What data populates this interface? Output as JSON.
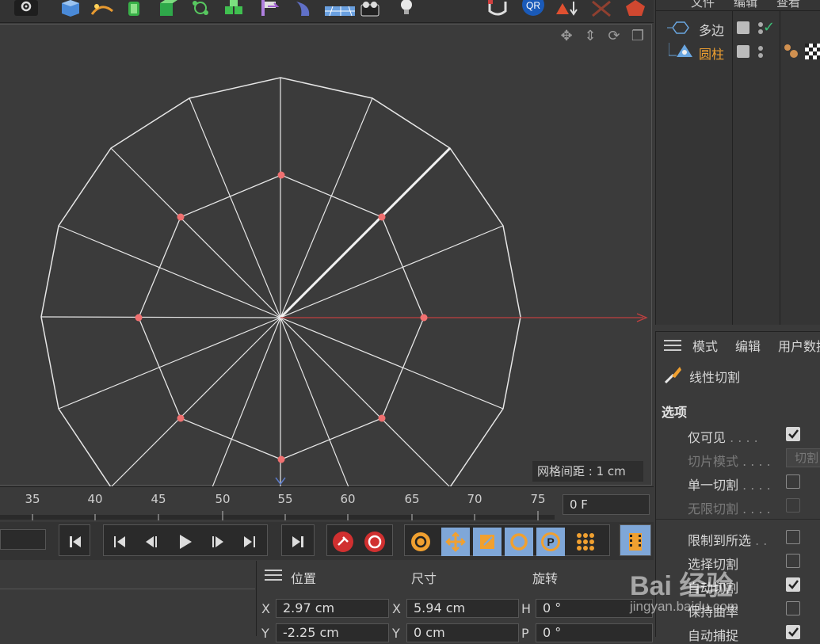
{
  "objects": {
    "menu": [
      "文件",
      "编辑",
      "查看"
    ],
    "items": [
      {
        "name": "多边",
        "selected": false
      },
      {
        "name": "圆柱",
        "selected": true
      }
    ]
  },
  "attributes": {
    "tabs": [
      "模式",
      "编辑",
      "用户数据"
    ],
    "tool_name": "线性切割",
    "section": "选项",
    "options": [
      {
        "label": "仅可见",
        "dots": ". . . .",
        "state": "checked"
      },
      {
        "label": "切片模式",
        "dots": ". . . .",
        "state": "dropdown",
        "value": "切割"
      },
      {
        "label": "单一切割",
        "dots": ". . . .",
        "state": "unchecked"
      },
      {
        "label": "无限切割",
        "dots": ". . . .",
        "state": "disabled"
      },
      {
        "label": "限制到所选",
        "dots": ". .",
        "state": "unchecked"
      },
      {
        "label": "选择切割",
        "dots": "",
        "state": "unchecked"
      },
      {
        "label": "自动切割",
        "dots": "",
        "state": "checked"
      },
      {
        "label": "保持曲率",
        "dots": "",
        "state": "unchecked"
      },
      {
        "label": "自动捕捉",
        "dots": "",
        "state": "checked"
      }
    ]
  },
  "viewport": {
    "grid_spacing": "网格间距 : 1 cm"
  },
  "timeline": {
    "ticks": [
      "35",
      "40",
      "45",
      "50",
      "55",
      "60",
      "65",
      "70",
      "75"
    ],
    "current_frame": "0 F"
  },
  "coordinates": {
    "headers": [
      "位置",
      "尺寸",
      "旋转"
    ],
    "rows": [
      {
        "axis_pos": "X",
        "pos": "2.97 cm",
        "axis_size": "X",
        "size": "5.94 cm",
        "axis_rot": "H",
        "rot": "0 °"
      },
      {
        "axis_pos": "Y",
        "pos": "-2.25 cm",
        "axis_size": "Y",
        "size": "0 cm",
        "axis_rot": "P",
        "rot": "0 °"
      }
    ]
  },
  "watermark": {
    "brand": "Bai 经验",
    "url": "jingyan.baidu.com"
  },
  "colors": {
    "accent_orange": "#f0a030",
    "point_red": "#f07070",
    "axis_red": "#c04040",
    "active_blue": "#7fa7d8"
  }
}
